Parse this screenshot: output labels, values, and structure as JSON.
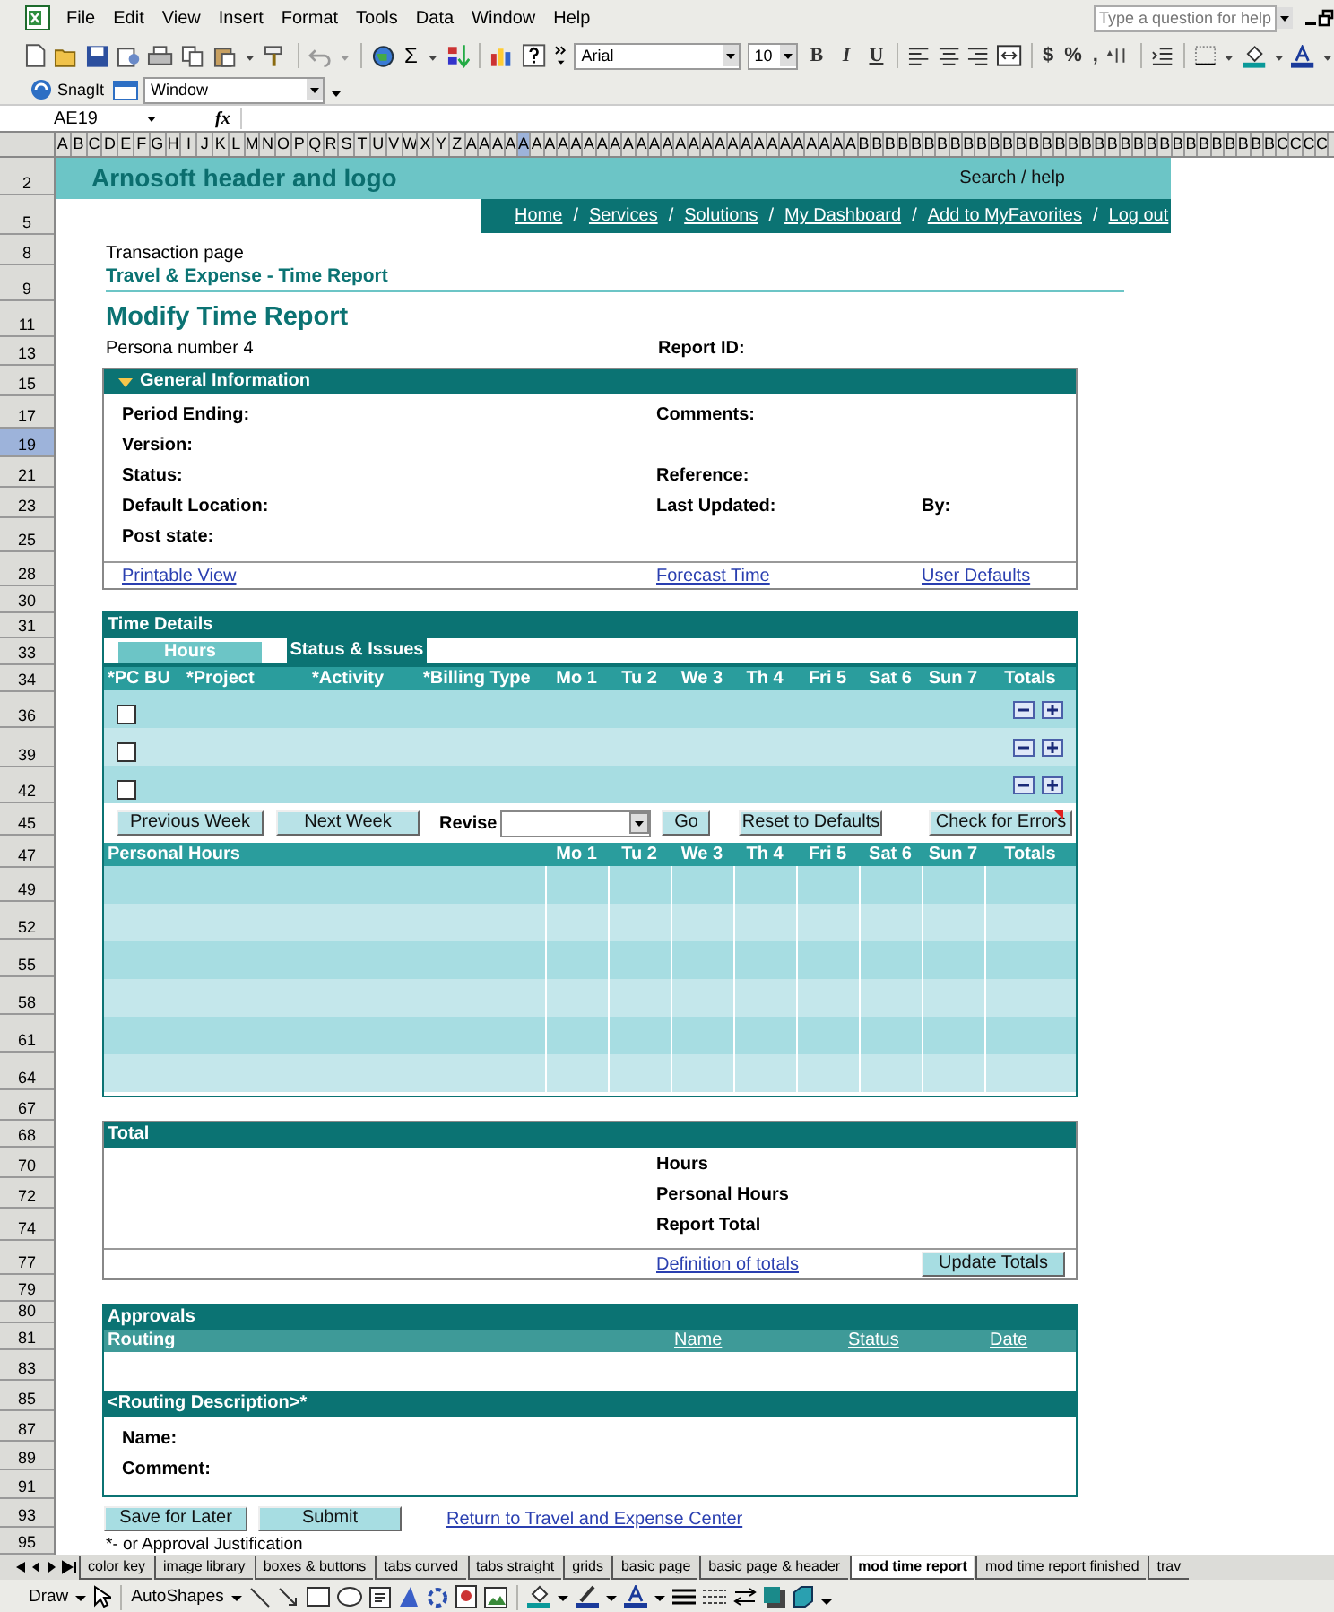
{
  "menus": [
    "File",
    "Edit",
    "View",
    "Insert",
    "Format",
    "Tools",
    "Data",
    "Window",
    "Help"
  ],
  "help_box": {
    "placeholder": "Type a question for help"
  },
  "toolbar": {
    "sum_symbol": "Σ",
    "font": "Arial",
    "size": "10",
    "format_buttons": [
      "B",
      "I",
      "U"
    ],
    "number_buttons": [
      "$",
      "%",
      ","
    ]
  },
  "snagit": {
    "label": "SnagIt",
    "window_select": "Window"
  },
  "formula_bar": {
    "name_box": "AE19",
    "fx": "fx"
  },
  "column_headers": [
    {
      "label": "A",
      "selected": false
    },
    {
      "label": "B",
      "selected": false
    },
    {
      "label": "C",
      "selected": false
    },
    {
      "label": "D",
      "selected": false
    },
    {
      "label": "E",
      "selected": false
    },
    {
      "label": "F",
      "selected": false
    },
    {
      "label": "G",
      "selected": false
    },
    {
      "label": "H",
      "selected": false
    },
    {
      "label": "I",
      "selected": false
    },
    {
      "label": "J",
      "selected": false
    },
    {
      "label": "K",
      "selected": false
    },
    {
      "label": "L",
      "selected": false
    },
    {
      "label": "M",
      "selected": false
    },
    {
      "label": "N",
      "selected": false
    },
    {
      "label": "O",
      "selected": false
    },
    {
      "label": "P",
      "selected": false
    },
    {
      "label": "Q",
      "selected": false
    },
    {
      "label": "R",
      "selected": false
    },
    {
      "label": "S",
      "selected": false
    },
    {
      "label": "T",
      "selected": false
    },
    {
      "label": "U",
      "selected": false
    },
    {
      "label": "V",
      "selected": false
    },
    {
      "label": "W",
      "selected": false
    },
    {
      "label": "X",
      "selected": false
    },
    {
      "label": "Y",
      "selected": false
    },
    {
      "label": "Z",
      "selected": false
    },
    {
      "label": "A",
      "selected": false
    },
    {
      "label": "A",
      "selected": false
    },
    {
      "label": "A",
      "selected": false
    },
    {
      "label": "A",
      "selected": false
    },
    {
      "label": "A",
      "selected": true
    },
    {
      "label": "A",
      "selected": false
    },
    {
      "label": "A",
      "selected": false
    },
    {
      "label": "A",
      "selected": false
    },
    {
      "label": "A",
      "selected": false
    },
    {
      "label": "A",
      "selected": false
    },
    {
      "label": "A",
      "selected": false
    },
    {
      "label": "A",
      "selected": false
    },
    {
      "label": "A",
      "selected": false
    },
    {
      "label": "A",
      "selected": false
    },
    {
      "label": "A",
      "selected": false
    },
    {
      "label": "A",
      "selected": false
    },
    {
      "label": "A",
      "selected": false
    },
    {
      "label": "A",
      "selected": false
    },
    {
      "label": "A",
      "selected": false
    },
    {
      "label": "A",
      "selected": false
    },
    {
      "label": "A",
      "selected": false
    },
    {
      "label": "A",
      "selected": false
    },
    {
      "label": "A",
      "selected": false
    },
    {
      "label": "A",
      "selected": false
    },
    {
      "label": "A",
      "selected": false
    },
    {
      "label": "A",
      "selected": false
    },
    {
      "label": "A",
      "selected": false
    },
    {
      "label": "A",
      "selected": false
    },
    {
      "label": "A",
      "selected": false
    },
    {
      "label": "A",
      "selected": false
    },
    {
      "label": "B",
      "selected": false
    },
    {
      "label": "B",
      "selected": false
    },
    {
      "label": "B",
      "selected": false
    },
    {
      "label": "B",
      "selected": false
    },
    {
      "label": "B",
      "selected": false
    },
    {
      "label": "B",
      "selected": false
    },
    {
      "label": "B",
      "selected": false
    },
    {
      "label": "B",
      "selected": false
    },
    {
      "label": "B",
      "selected": false
    },
    {
      "label": "B",
      "selected": false
    },
    {
      "label": "B",
      "selected": false
    },
    {
      "label": "B",
      "selected": false
    },
    {
      "label": "B",
      "selected": false
    },
    {
      "label": "B",
      "selected": false
    },
    {
      "label": "B",
      "selected": false
    },
    {
      "label": "B",
      "selected": false
    },
    {
      "label": "B",
      "selected": false
    },
    {
      "label": "B",
      "selected": false
    },
    {
      "label": "B",
      "selected": false
    },
    {
      "label": "B",
      "selected": false
    },
    {
      "label": "B",
      "selected": false
    },
    {
      "label": "B",
      "selected": false
    },
    {
      "label": "B",
      "selected": false
    },
    {
      "label": "B",
      "selected": false
    },
    {
      "label": "B",
      "selected": false
    },
    {
      "label": "B",
      "selected": false
    },
    {
      "label": "B",
      "selected": false
    },
    {
      "label": "B",
      "selected": false
    },
    {
      "label": "B",
      "selected": false
    },
    {
      "label": "B",
      "selected": false
    },
    {
      "label": "B",
      "selected": false
    },
    {
      "label": "B",
      "selected": false
    },
    {
      "label": "C",
      "selected": false
    },
    {
      "label": "C",
      "selected": false
    },
    {
      "label": "C",
      "selected": false
    },
    {
      "label": "C",
      "selected": false
    }
  ],
  "row_headers": [
    {
      "label": "2",
      "selected": false
    },
    {
      "label": "5",
      "selected": false
    },
    {
      "label": "8",
      "selected": false
    },
    {
      "label": "9",
      "selected": false
    },
    {
      "label": "11",
      "selected": false
    },
    {
      "label": "13",
      "selected": false
    },
    {
      "label": "15",
      "selected": false
    },
    {
      "label": "17",
      "selected": false
    },
    {
      "label": "19",
      "selected": true
    },
    {
      "label": "21",
      "selected": false
    },
    {
      "label": "23",
      "selected": false
    },
    {
      "label": "25",
      "selected": false
    },
    {
      "label": "28",
      "selected": false
    },
    {
      "label": "30",
      "selected": false
    },
    {
      "label": "31",
      "selected": false
    },
    {
      "label": "33",
      "selected": false
    },
    {
      "label": "34",
      "selected": false
    },
    {
      "label": "36",
      "selected": false
    },
    {
      "label": "39",
      "selected": false
    },
    {
      "label": "42",
      "selected": false
    },
    {
      "label": "45",
      "selected": false
    },
    {
      "label": "47",
      "selected": false
    },
    {
      "label": "49",
      "selected": false
    },
    {
      "label": "52",
      "selected": false
    },
    {
      "label": "55",
      "selected": false
    },
    {
      "label": "58",
      "selected": false
    },
    {
      "label": "61",
      "selected": false
    },
    {
      "label": "64",
      "selected": false
    },
    {
      "label": "67",
      "selected": false
    },
    {
      "label": "68",
      "selected": false
    },
    {
      "label": "70",
      "selected": false
    },
    {
      "label": "72",
      "selected": false
    },
    {
      "label": "74",
      "selected": false
    },
    {
      "label": "77",
      "selected": false
    },
    {
      "label": "79",
      "selected": false
    },
    {
      "label": "80",
      "selected": false
    },
    {
      "label": "81",
      "selected": false
    },
    {
      "label": "83",
      "selected": false
    },
    {
      "label": "85",
      "selected": false
    },
    {
      "label": "87",
      "selected": false
    },
    {
      "label": "89",
      "selected": false
    },
    {
      "label": "91",
      "selected": false
    },
    {
      "label": "93",
      "selected": false
    },
    {
      "label": "95",
      "selected": false
    }
  ],
  "page": {
    "header": {
      "logo": "Arnosoft header and logo",
      "search": "Search / help"
    },
    "nav": [
      {
        "kind": "link",
        "label": "Home"
      },
      {
        "kind": "separator",
        "label": "/"
      },
      {
        "kind": "link",
        "label": "Services"
      },
      {
        "kind": "separator",
        "label": "/"
      },
      {
        "kind": "link",
        "label": "Solutions"
      },
      {
        "kind": "separator",
        "label": "/"
      },
      {
        "kind": "link",
        "label": "My Dashboard"
      },
      {
        "kind": "separator",
        "label": "/"
      },
      {
        "kind": "link",
        "label": "Add to MyFavorites"
      },
      {
        "kind": "separator",
        "label": "/"
      },
      {
        "kind": "link",
        "label": "Log out"
      }
    ],
    "breadcrumb": "Transaction page",
    "subtitle": "Travel & Expense - Time Report",
    "title": "Modify Time Report",
    "persona": "Persona number 4",
    "report_id": "Report ID:",
    "general_info": {
      "title": "General Information",
      "expanded": true,
      "rows": [
        {
          "left": "Period Ending:",
          "middle": "Comments:"
        },
        {
          "left": "Version:"
        },
        {
          "left": "Status:",
          "middle": "Reference:"
        },
        {
          "left": "Default Location:",
          "middle": "Last Updated:",
          "right": "By:"
        },
        {
          "left": "Post state:"
        }
      ],
      "links": {
        "left": "Printable View",
        "middle": "Forecast Time",
        "right": "User Defaults"
      }
    },
    "time_details": {
      "title": "Time Details",
      "tabs": [
        {
          "label": "Hours",
          "selected": false
        },
        {
          "label": "Status & Issues",
          "selected": true
        }
      ],
      "columns": [
        "*PC BU",
        "*Project",
        "*Activity",
        "*Billing Type",
        "Mo 1",
        "Tu 2",
        "We 3",
        "Th 4",
        "Fri 5",
        "Sat 6",
        "Sun 7",
        "Totals"
      ],
      "rows": [
        {
          "checked": false
        },
        {
          "checked": false
        },
        {
          "checked": false
        }
      ],
      "actions": {
        "previous": "Previous Week",
        "next": "Next Week",
        "revise_label": "Revise",
        "go": "Go",
        "reset": "Reset to Defaults",
        "check": "Check for Errors"
      },
      "personal_columns": [
        "Personal Hours",
        "Mo 1",
        "Tu 2",
        "We 3",
        "Th 4",
        "Fri 5",
        "Sat 6",
        "Sun 7",
        "Totals"
      ]
    },
    "totals": {
      "title": "Total",
      "labels": [
        "Hours",
        "Personal Hours",
        "Report Total"
      ],
      "link": "Definition of totals",
      "button": "Update Totals"
    },
    "approvals": {
      "title": "Approvals",
      "routing": "Routing",
      "columns": [
        "Name",
        "Status",
        "Date"
      ],
      "description_title": "<Routing Description>*",
      "fields": [
        "Name:",
        "Comment:"
      ]
    },
    "buttons": [
      "Save for Later",
      "Submit"
    ],
    "return_link": "Return to Travel and Expense Center",
    "footnote": "*- or Approval Justification"
  },
  "sheet_tabs": [
    {
      "label": "color key",
      "selected": false
    },
    {
      "label": "image library",
      "selected": false
    },
    {
      "label": "boxes & buttons",
      "selected": false
    },
    {
      "label": "tabs curved",
      "selected": false
    },
    {
      "label": "tabs straight",
      "selected": false
    },
    {
      "label": "grids",
      "selected": false
    },
    {
      "label": "basic page",
      "selected": false
    },
    {
      "label": "basic page & header",
      "selected": false
    },
    {
      "label": "mod time report",
      "selected": true
    },
    {
      "label": "mod time report finished",
      "selected": false
    },
    {
      "label": "trav",
      "selected": false
    }
  ],
  "drawing_toolbar": {
    "draw": "Draw",
    "autoshapes": "AutoShapes"
  }
}
